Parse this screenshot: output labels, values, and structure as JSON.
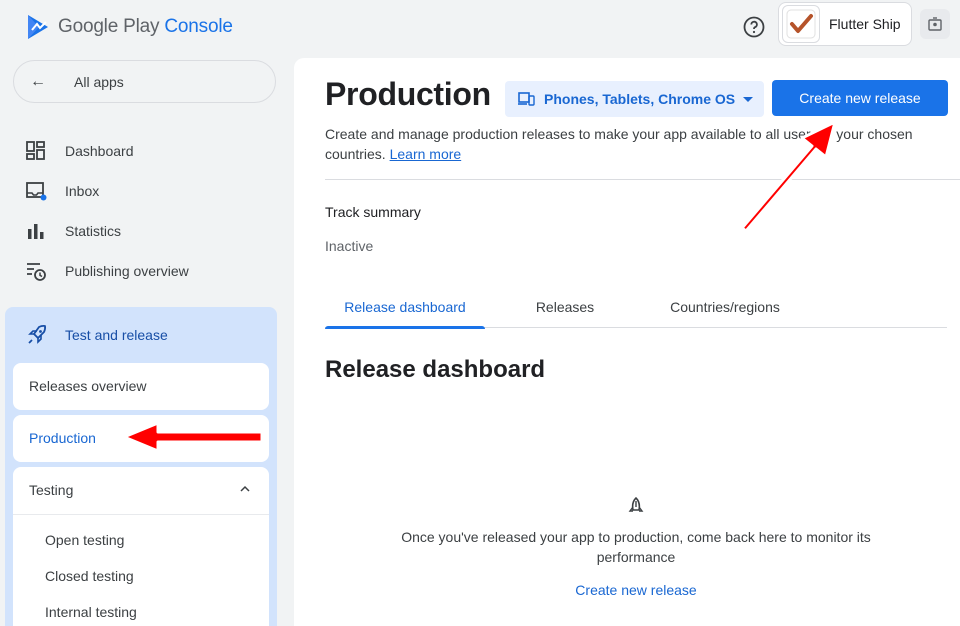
{
  "header": {
    "logo_text_1": "Google Play",
    "logo_text_2": "Console",
    "app_name": "Flutter Ship",
    "icons": [
      "play-console-logo-icon",
      "help-icon",
      "app-check-icon",
      "account-icon"
    ]
  },
  "sidebar": {
    "back_label": "All apps",
    "items": [
      {
        "label": "Dashboard",
        "icon": "dashboard-icon"
      },
      {
        "label": "Inbox",
        "icon": "inbox-icon"
      },
      {
        "label": "Statistics",
        "icon": "statistics-icon"
      },
      {
        "label": "Publishing overview",
        "icon": "publishing-overview-icon"
      }
    ],
    "section": {
      "label": "Test and release",
      "icon": "rocket-icon",
      "releases_overview": "Releases overview",
      "production": "Production",
      "testing": "Testing",
      "testing_items": [
        "Open testing",
        "Closed testing",
        "Internal testing"
      ]
    }
  },
  "main": {
    "title": "Production",
    "device_select": "Phones, Tablets, Chrome OS",
    "create_button": "Create new release",
    "description": "Create and manage production releases to make your app available to all users in your chosen countries.",
    "learn_more": "Learn more",
    "track_summary_label": "Track summary",
    "track_status": "Inactive",
    "tabs": [
      "Release dashboard",
      "Releases",
      "Countries/regions"
    ],
    "active_tab": "Release dashboard",
    "section_title": "Release dashboard",
    "empty_text": "Once you've released your app to production, come back here to monitor its performance",
    "empty_link": "Create new release"
  },
  "colors": {
    "accent": "#1a73e8",
    "active_text": "#1967d2",
    "section_bg": "#d2e3fc",
    "annotation_arrow": "#ff0000"
  }
}
